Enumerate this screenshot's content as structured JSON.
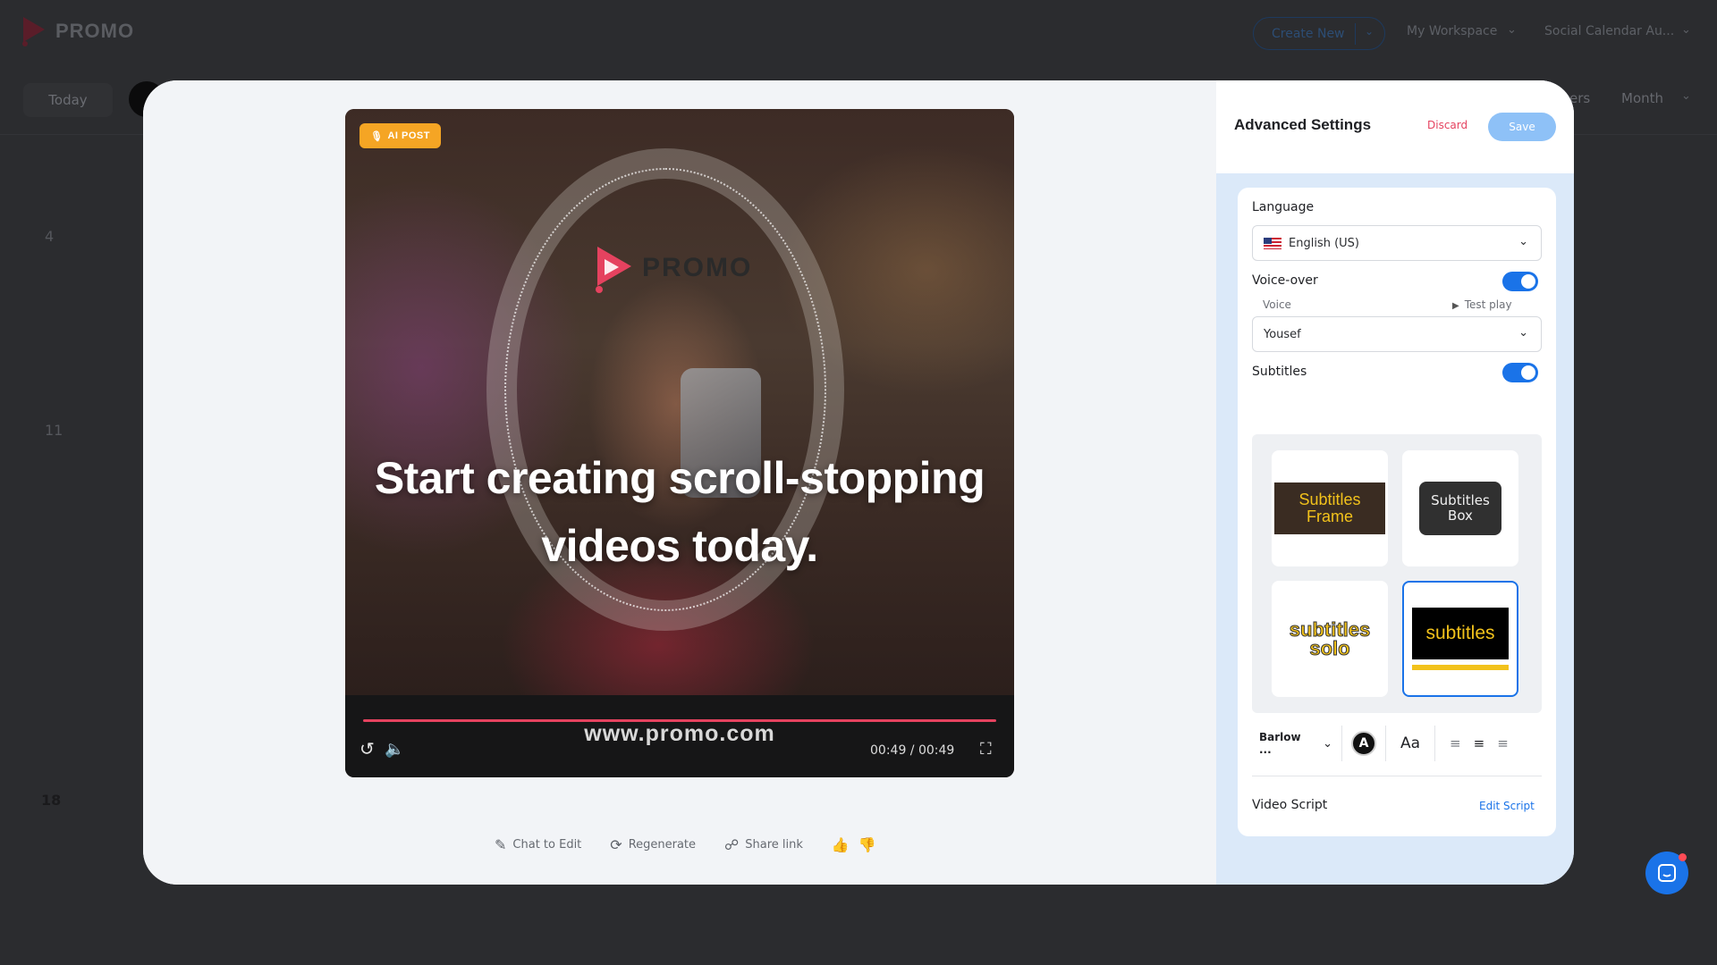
{
  "app": {
    "logo_text": "PROMO"
  },
  "header": {
    "create_new": "Create New",
    "workspace": "My Workspace",
    "social_calendar": "Social Calendar Au..."
  },
  "calendar": {
    "today": "Today",
    "filters": "ers",
    "view": "Month",
    "days": [
      "4",
      "11",
      "18"
    ]
  },
  "video": {
    "badge": "AI POST",
    "brand": "PROMO",
    "caption": "Start creating scroll-stopping videos today.",
    "url": "www.promo.com",
    "time": "00:49 / 00:49",
    "progress": 1.0
  },
  "actions": {
    "chat": "Chat to Edit",
    "regenerate": "Regenerate",
    "share": "Share link"
  },
  "settings": {
    "title": "Advanced Settings",
    "discard": "Discard",
    "save": "Save",
    "language_label": "Language",
    "language_value": "English (US)",
    "voiceover_label": "Voice-over",
    "voiceover_on": true,
    "voice_label": "Voice",
    "test_play": "Test play",
    "voice_value": "Yousef",
    "subtitles_label": "Subtitles",
    "subtitles_on": true,
    "styles": {
      "frame_line1": "Subtitles",
      "frame_line2": "Frame",
      "box_line1": "Subtitles",
      "box_line2": "Box",
      "solo_line1": "subtitles",
      "solo_line2": "solo",
      "bar": "subtitles",
      "selected": "bar"
    },
    "font": "Barlow ...",
    "color_letter": "A",
    "case_label": "Aa",
    "script_label": "Video Script",
    "edit_script": "Edit Script"
  },
  "colors": {
    "accent": "#1a73e8",
    "brand": "#e5425f",
    "badge": "#f5a524"
  }
}
